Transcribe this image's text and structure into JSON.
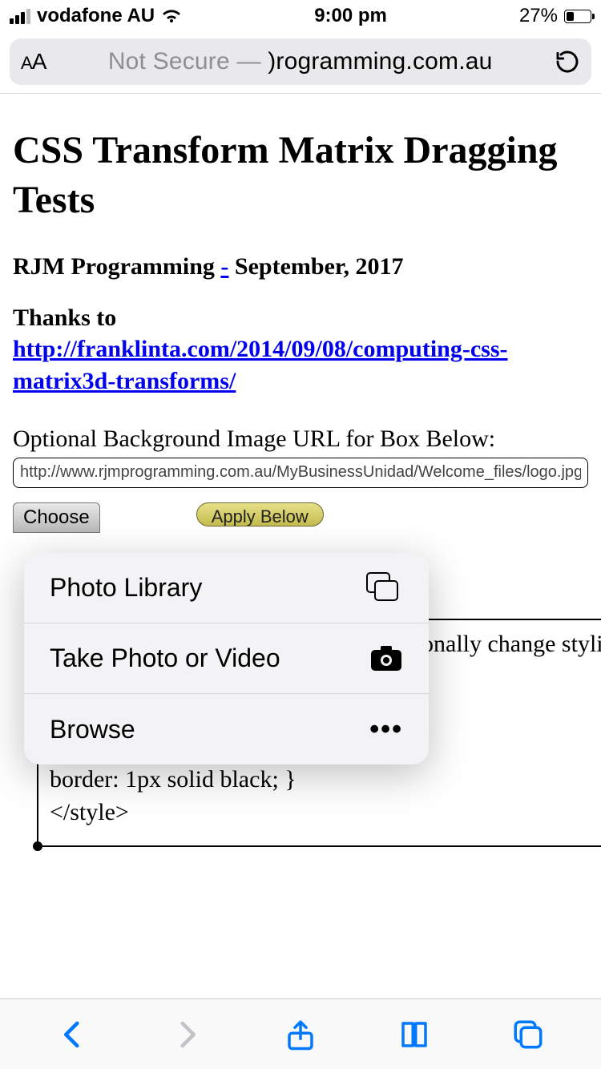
{
  "status_bar": {
    "carrier": "vodafone AU",
    "time": "9:00 pm",
    "battery_pct": "27%"
  },
  "url_bar": {
    "security": "Not Secure",
    "separator": "—",
    "domain": ")rogramming.com.au"
  },
  "page": {
    "title": "CSS Transform Matrix Dragging Tests",
    "author": "RJM Programming",
    "dash": "-",
    "date": "September, 2017",
    "thanks_label": "Thanks to",
    "thanks_link": "http://franklinta.com/2014/09/08/computing-css-matrix3d-transforms/",
    "input_label": "Optional Background Image URL for Box Below:",
    "input_value": "http://www.rjmprogramming.com.au/MyBusinessUnidad/Welcome_files/logo.jpg",
    "choose_btn": "Choose",
    "apply_btn": "Apply Below",
    "hint_fragment": "onally change styling",
    "code_line1": "border: 1px solid black; }",
    "code_line2": "</style>"
  },
  "action_sheet": {
    "photo_library": "Photo Library",
    "take_photo": "Take Photo or Video",
    "browse": "Browse"
  }
}
